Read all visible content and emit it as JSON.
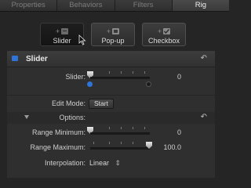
{
  "tabs": [
    {
      "label": "Properties"
    },
    {
      "label": "Behaviors"
    },
    {
      "label": "Filters"
    },
    {
      "label": "Rig"
    }
  ],
  "widget_buttons": [
    {
      "label": "Slider",
      "plus": "+",
      "icon": "slider-widget-icon"
    },
    {
      "label": "Pop-up",
      "plus": "+",
      "icon": "popup-widget-icon"
    },
    {
      "label": "Checkbox",
      "plus": "+",
      "icon": "checkbox-widget-icon"
    }
  ],
  "colors": {
    "accent_blue": "#2f74d8",
    "panel_bg": "#2f2f2f",
    "background": "#252525"
  },
  "section": {
    "title": "Slider",
    "reset_glyph": "↶"
  },
  "slider": {
    "label": "Slider:",
    "value": "0"
  },
  "edit_mode": {
    "label": "Edit Mode:",
    "button": "Start"
  },
  "options": {
    "label": "Options:",
    "reset_glyph": "↶"
  },
  "range_min": {
    "label": "Range Minimum:",
    "value": "0"
  },
  "range_max": {
    "label": "Range Maximum:",
    "value": "100.0"
  },
  "interpolation": {
    "label": "Interpolation:",
    "value": "Linear",
    "stepper": "⇕"
  }
}
